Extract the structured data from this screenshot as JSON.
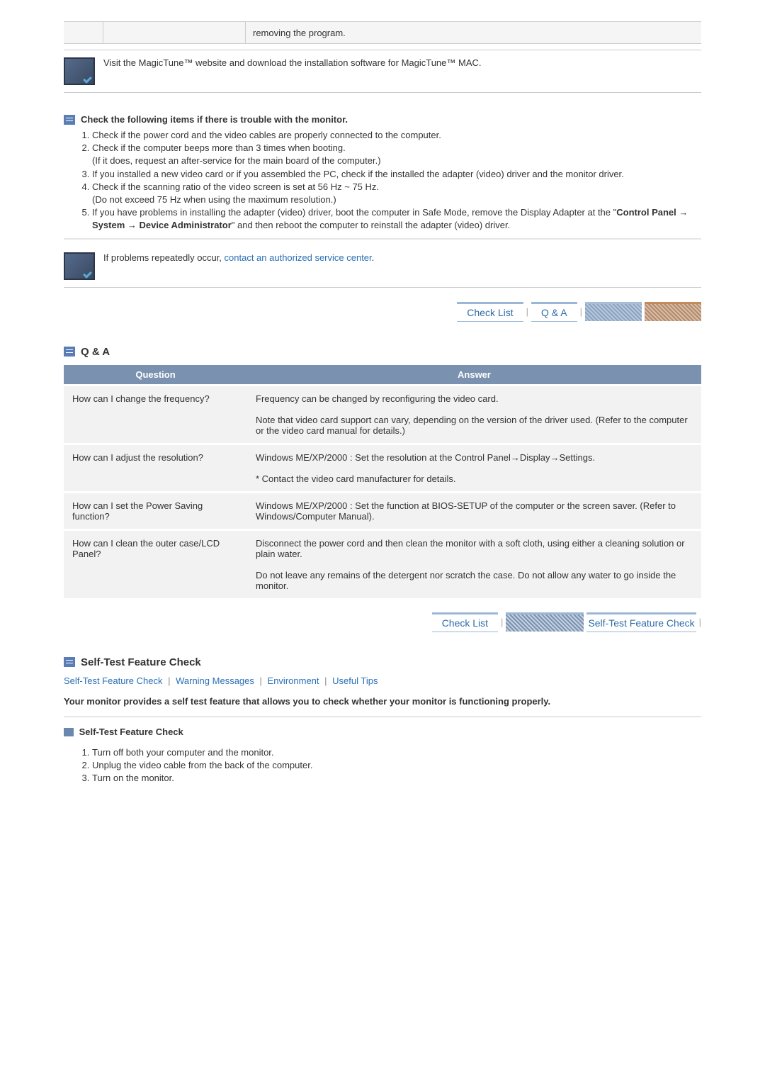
{
  "top_cell_text": "removing the program.",
  "magictune_box": "Visit the MagicTune™ website and download the installation software for MagicTune™ MAC.",
  "checklist": {
    "heading": "Check the following items if there is trouble with the monitor.",
    "items": [
      "Check if the power cord and the video cables are properly connected to the computer.",
      "Check if the computer beeps more than 3 times when booting.\n(If it does, request an after-service for the main board of the computer.)",
      "If you installed a new video card or if you assembled the PC, check if the installed the adapter (video) driver and the monitor driver.",
      "Check if the scanning ratio of the video screen is set at 56 Hz ~ 75 Hz.\n(Do not exceed 75 Hz when using the maximum resolution.)"
    ],
    "item5_pre": "If you have problems in installing the adapter (video) driver, boot the computer in Safe Mode, remove the Display Adapter at the \"",
    "item5_bold": "Control Panel → System → Device Administrator",
    "item5_post": "\" and then reboot the computer to reinstall the adapter (video) driver."
  },
  "contact_box_pre": "If problems repeatedly occur, ",
  "contact_box_link": "contact an authorized service center",
  "tabs1": {
    "checklist": "Check List",
    "qa": "Q & A"
  },
  "qa": {
    "heading": "Q & A",
    "header_q": "Question",
    "header_a": "Answer",
    "rows": [
      {
        "q": "How can I change the frequency?",
        "a": "Frequency can be changed by reconfiguring the video card.\n\nNote that video card support can vary, depending on the version of the driver used. (Refer to the computer or the video card manual for details.)"
      },
      {
        "q": "How can I adjust the resolution?",
        "a": "Windows ME/XP/2000 : Set the resolution at the Control Panel→Display→Settings.\n\n* Contact the video card manufacturer for details."
      },
      {
        "q": "How can I set the Power Saving function?",
        "a": "Windows ME/XP/2000 : Set the function at BIOS-SETUP of the computer or the screen saver. (Refer to Windows/Computer Manual)."
      },
      {
        "q": "How can I clean the outer case/LCD Panel?",
        "a": "Disconnect the power cord and then clean the monitor with a soft cloth, using either a cleaning solution or plain water.\n\nDo not leave any remains of the detergent nor scratch the case. Do not allow any water to go inside the monitor."
      }
    ]
  },
  "tabs2": {
    "checklist": "Check List",
    "selftest": "Self-Test Feature Check"
  },
  "selftest": {
    "heading": "Self-Test Feature Check",
    "subnav": {
      "a": "Self-Test Feature Check",
      "b": "Warning Messages",
      "c": "Environment",
      "d": "Useful Tips"
    },
    "intro": "Your monitor provides a self test feature that allows you to check whether your monitor is functioning properly.",
    "subheading": "Self-Test Feature Check",
    "steps": [
      "Turn off both your computer and the monitor.",
      "Unplug the video cable from the back of the computer.",
      "Turn on the monitor."
    ]
  }
}
